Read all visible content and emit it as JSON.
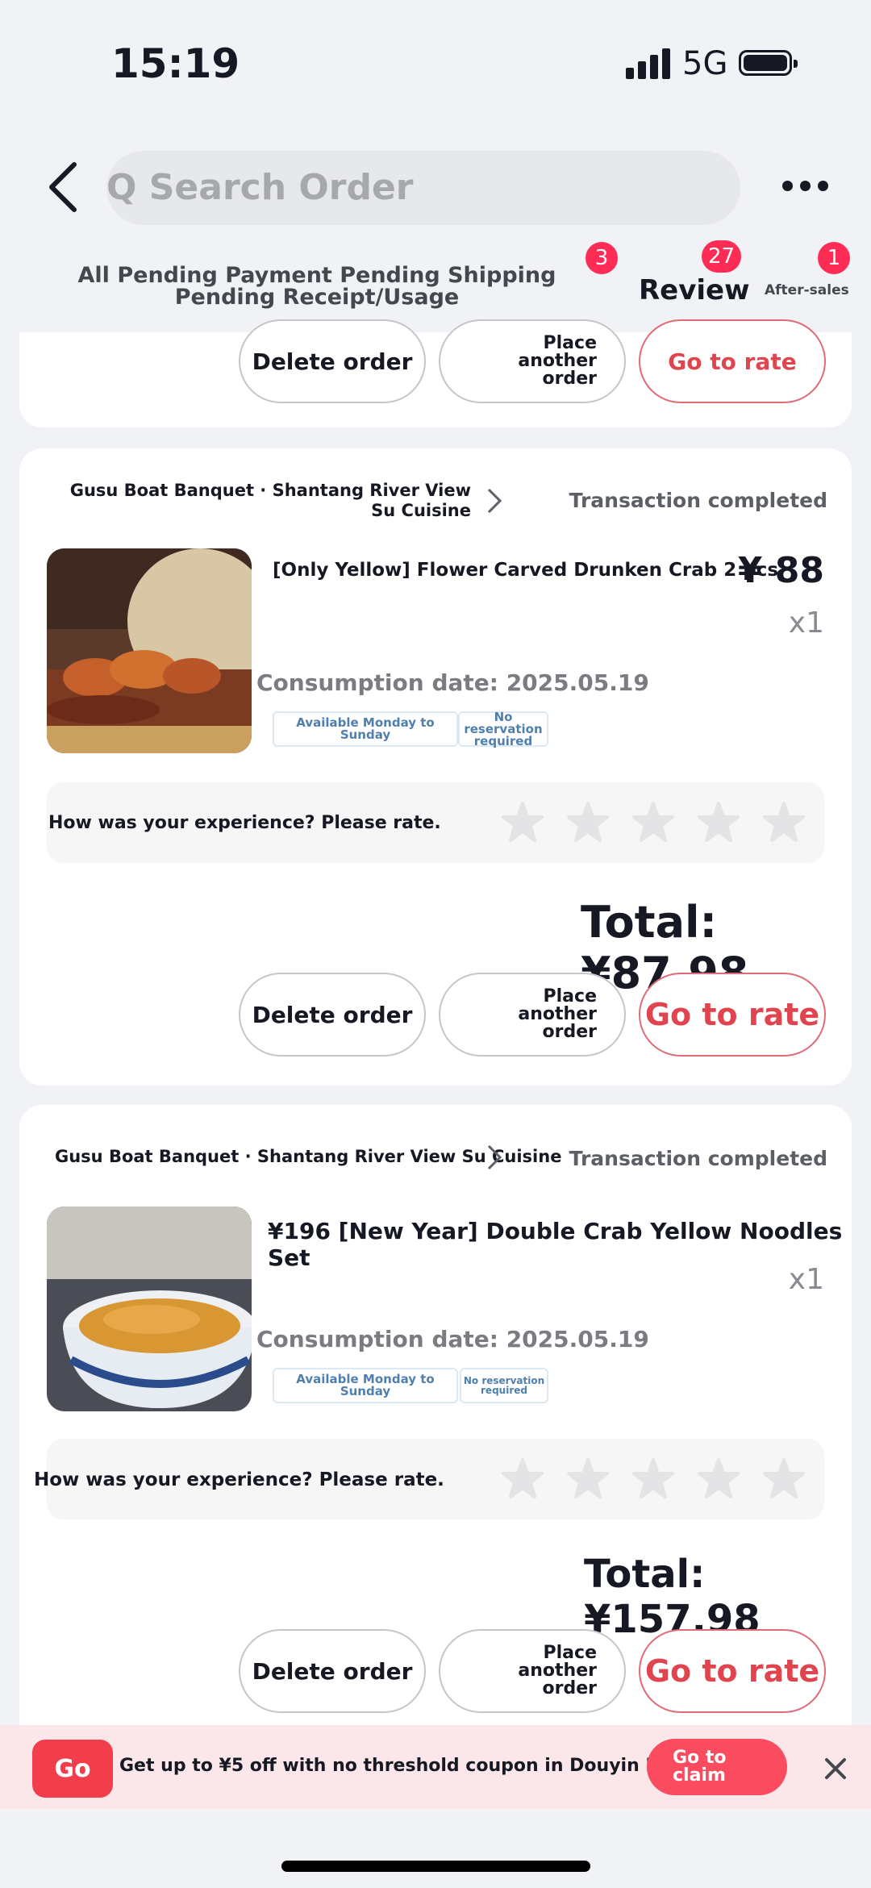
{
  "status_bar": {
    "time": "15:19",
    "network": "5G"
  },
  "header": {
    "search_placeholder": "Q Search Order"
  },
  "tabs": {
    "all_label": "All Pending Payment Pending Shipping Pending Receipt/Usage",
    "review_label": "Review",
    "after_sales_label": "After-sales",
    "badges": [
      "3",
      "27",
      "1"
    ]
  },
  "buttons": {
    "delete": "Delete order",
    "place_again": "Place another order",
    "rate": "Go to rate"
  },
  "orders": [
    {
      "shop": "Gusu Boat Banquet · Shantang River View Su Cuisine",
      "status": "Transaction completed",
      "title": "[Only Yellow] Flower Carved Drunken Crab 2 pcs",
      "price": "¥ 88",
      "qty": "x1",
      "consumption": "Consumption date: 2025.05.19",
      "tags": [
        "Available Monday to Sunday",
        "No reservation required"
      ],
      "rate_prompt": "How was your experience? Please rate.",
      "total": "Total: ¥87.98"
    },
    {
      "shop": "Gusu Boat Banquet · Shantang River View Su Cuisine",
      "status": "Transaction completed",
      "title": "¥196 [New Year] Double Crab Yellow Noodles Set",
      "qty": "x1",
      "consumption": "Consumption date: 2025.05.19",
      "tags": [
        "Available Monday to Sunday",
        "No reservation required"
      ],
      "rate_prompt": "How was your experience? Please rate.",
      "total": "Total: ¥157.98"
    }
  ],
  "banner": {
    "badge": "Go",
    "text": "Get up to ¥5 off with no threshold coupon in Douyin Mall App",
    "claim": "Go to claim"
  },
  "colors": {
    "accent": "#fe2c55",
    "rate": "#e0454f",
    "tag": "#4f7fae"
  }
}
